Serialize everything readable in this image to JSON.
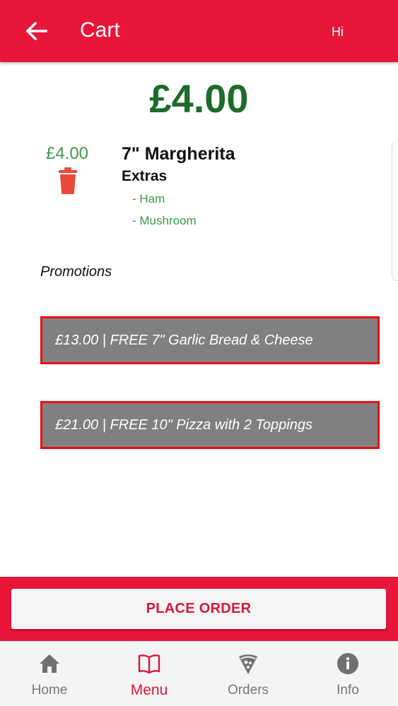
{
  "app_bar": {
    "title": "Cart",
    "greeting": "Hi",
    "back_icon": "arrow-left-icon",
    "color": "#e8173a"
  },
  "cart": {
    "total": "£4.00",
    "items": [
      {
        "price": "£4.00",
        "name": "7\" Margherita",
        "extras_label": "Extras",
        "extras": [
          "- Ham",
          "- Mushroom"
        ],
        "delete_icon": "trash-icon"
      }
    ]
  },
  "promotions": {
    "label": "Promotions",
    "items": [
      "£13.00 | FREE 7\" Garlic Bread & Cheese",
      "£21.00 | FREE 10\" Pizza with 2 Toppings"
    ]
  },
  "actions": {
    "place_order": "PLACE ORDER"
  },
  "bottom_nav": {
    "items": [
      {
        "label": "Home",
        "icon": "home-icon",
        "active": false
      },
      {
        "label": "Menu",
        "icon": "book-icon",
        "active": true
      },
      {
        "label": "Orders",
        "icon": "pizza-slice-icon",
        "active": false
      },
      {
        "label": "Info",
        "icon": "info-icon",
        "active": false
      }
    ]
  },
  "colors": {
    "brand_red": "#e8173a",
    "price_green": "#1e6b2a",
    "extra_green": "#3e9a48",
    "promo_gray": "#808080",
    "promo_border": "#ee0b13",
    "trash_red": "#ea4a3c"
  }
}
